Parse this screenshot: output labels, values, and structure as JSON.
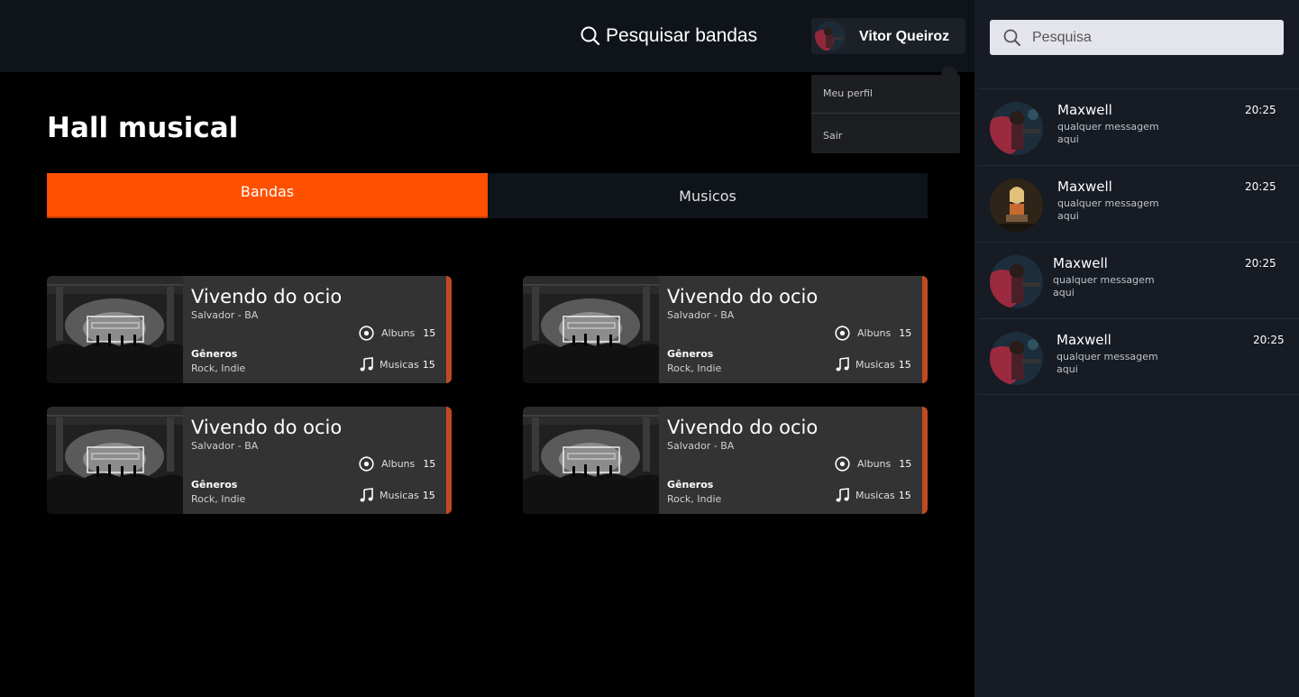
{
  "header": {
    "search_label": "Pesquisar bandas",
    "user_name": "Vitor Queiroz"
  },
  "user_menu": {
    "items": [
      "Meu perfil",
      "Sair"
    ]
  },
  "main": {
    "title": "Hall musical",
    "tabs": [
      {
        "label": "Bandas",
        "active": true
      },
      {
        "label": "Musicos",
        "active": false
      }
    ],
    "bands": [
      {
        "name": "Vivendo do ocio",
        "location": "Salvador - BA",
        "genres_label": "Gêneros",
        "genres": "Rock, Indie",
        "albums_label": "Albuns",
        "albums": "15",
        "songs_label": "Musicas",
        "songs": "15"
      },
      {
        "name": "Vivendo do ocio",
        "location": "Salvador - BA",
        "genres_label": "Gêneros",
        "genres": "Rock, Indie",
        "albums_label": "Albuns",
        "albums": "15",
        "songs_label": "Musicas",
        "songs": "15"
      },
      {
        "name": "Vivendo do ocio",
        "location": "Salvador - BA",
        "genres_label": "Gêneros",
        "genres": "Rock, Indie",
        "albums_label": "Albuns",
        "albums": "15",
        "songs_label": "Musicas",
        "songs": "15"
      },
      {
        "name": "Vivendo do ocio",
        "location": "Salvador - BA",
        "genres_label": "Gêneros",
        "genres": "Rock, Indie",
        "albums_label": "Albuns",
        "albums": "15",
        "songs_label": "Musicas",
        "songs": "15"
      }
    ]
  },
  "chat": {
    "search_placeholder": "Pesquisa",
    "conversations": [
      {
        "name": "Maxwell",
        "message": "qualquer messagem aqui",
        "time": "20:25"
      },
      {
        "name": "Maxwell",
        "message": "qualquer messagem aqui",
        "time": "20:25"
      },
      {
        "name": "Maxwell",
        "message": "qualquer messagem aqui",
        "time": "20:25"
      },
      {
        "name": "Maxwell",
        "message": "qualquer messagem aqui",
        "time": "20:25"
      }
    ]
  },
  "colors": {
    "accent": "#ff5000",
    "card_accent": "#c04a22",
    "topbar": "#0f131a",
    "sidebar": "#171b23"
  }
}
